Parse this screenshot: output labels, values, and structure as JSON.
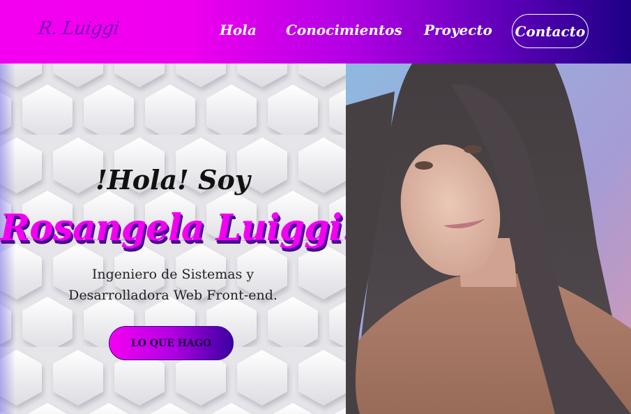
{
  "navbar": {
    "logo": "R. Luiggi",
    "links": [
      "Hola",
      "Conocimientos",
      "Proyecto",
      "Contacto"
    ]
  },
  "hero": {
    "greeting": "!Hola! Soy",
    "name": "Rosangela Luiggi.",
    "subtitle_line1": "Ingeniero de Sistemas y",
    "subtitle_line2": "Desarrolladora Web Front-end.",
    "cta": "LO QUE HAGO"
  },
  "colors": {
    "accent": "#f400f0",
    "deep": "#1d0086",
    "purple": "#5e00b8"
  }
}
